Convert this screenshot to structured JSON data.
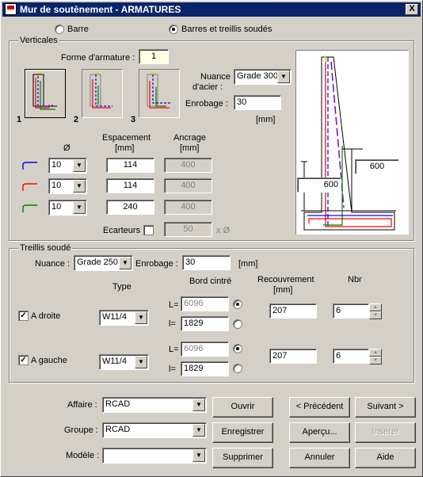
{
  "window": {
    "title": "Mur de soutènement - ARMATURES",
    "close_glyph": "X"
  },
  "mode": {
    "option_barre": "Barre",
    "option_barres_treillis": "Barres et treillis soudés",
    "selected": "Barres et treillis soudés"
  },
  "verticales": {
    "group_label": "Verticales",
    "forme_label": "Forme d'armature :",
    "forme_value": "1",
    "shapes": [
      "1",
      "2",
      "3"
    ],
    "selected_shape": "1",
    "nuance_label_1": "Nuance",
    "nuance_label_2": "d'acier :",
    "nuance_value": "Grade 300",
    "enrobage_label": "Enrobage :",
    "enrobage_value": "30",
    "enrobage_unit": "[mm]",
    "col_diam": "Ø",
    "col_espacement": "Espacement",
    "col_espacement_unit": "[mm]",
    "col_ancrage": "Ancrage",
    "col_ancrage_unit": "[mm]",
    "rows": [
      {
        "color": "#0000ff",
        "diam": "10",
        "espacement": "114",
        "ancrage": "400"
      },
      {
        "color": "#ff0000",
        "diam": "10",
        "espacement": "114",
        "ancrage": "400"
      },
      {
        "color": "#008000",
        "diam": "10",
        "espacement": "240",
        "ancrage": "400"
      }
    ],
    "ecarteurs_label": "Ecarteurs",
    "ecarteurs_value": "50",
    "ecarteurs_unit": "x Ø",
    "diagram_dim_1": "600",
    "diagram_dim_2": "600"
  },
  "treillis": {
    "group_label": "Treillis soudé",
    "nuance_label": "Nuance :",
    "nuance_value": "Grade 250",
    "enrobage_label": "Enrobage :",
    "enrobage_value": "30",
    "enrobage_unit": "[mm]",
    "col_type": "Type",
    "col_bord": "Bord cintré",
    "col_recouvrement": "Recouvrement",
    "col_recouvrement_unit": "[mm]",
    "col_nbr": "Nbr",
    "rows": [
      {
        "label": "A droite",
        "checked": true,
        "type": "W11/4",
        "L_label": "L=",
        "L": "6096",
        "l_label": "l=",
        "l": "1829",
        "bord_selected": "L",
        "recouvrement": "207",
        "nbr": "6"
      },
      {
        "label": "A gauche",
        "checked": true,
        "type": "W11/4",
        "L_label": "L=",
        "L": "6096",
        "l_label": "l=",
        "l": "1829",
        "bord_selected": "L",
        "recouvrement": "207",
        "nbr": "6"
      }
    ]
  },
  "footer": {
    "affaire_label": "Affaire :",
    "affaire_value": "RCAD",
    "groupe_label": "Groupe :",
    "groupe_value": "RCAD",
    "modele_label": "Modèle :",
    "modele_value": "",
    "btn_ouvrir": "Ouvrir",
    "btn_enregistrer": "Enregistrer",
    "btn_supprimer": "Supprimer",
    "btn_precedent": "< Précédent",
    "btn_suivant": "Suivant >",
    "btn_apercu": "Aperçu...",
    "btn_inserer": "Insérer",
    "btn_annuler": "Annuler",
    "btn_aide": "Aide"
  }
}
